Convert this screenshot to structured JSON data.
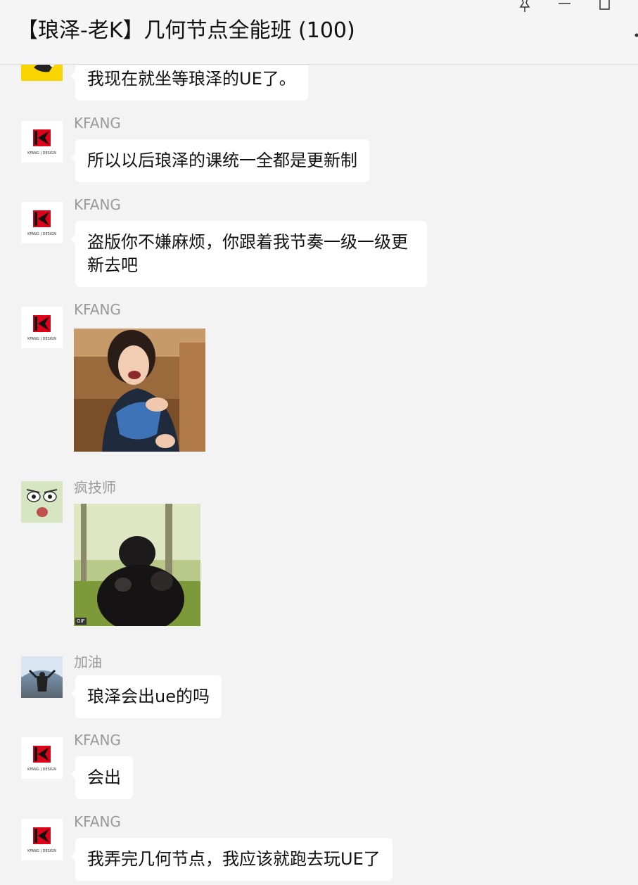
{
  "window": {
    "title": "【琅泽-老K】几何节点全能班 (100)"
  },
  "messages": [
    {
      "sender": "",
      "type": "text",
      "text": "我现在就坐等琅泽的UE了。"
    },
    {
      "sender": "KFANG",
      "type": "text",
      "text": "所以以后琅泽的课统一全都是更新制"
    },
    {
      "sender": "KFANG",
      "type": "text",
      "text": "盗版你不嫌麻烦，你跟着我节奏一级一级更新去吧"
    },
    {
      "sender": "KFANG",
      "type": "image",
      "image": "laughing-girl-pointing-sticker"
    },
    {
      "sender": "疯技师",
      "type": "image",
      "image": "gorilla-gif",
      "badge": "GIF"
    },
    {
      "sender": "加油",
      "type": "text",
      "text": "琅泽会出ue的吗"
    },
    {
      "sender": "KFANG",
      "type": "text",
      "text": "会出"
    },
    {
      "sender": "KFANG",
      "type": "text",
      "text": "我弄完几何节点，我应该就跑去玩UE了"
    }
  ],
  "logo": {
    "brand_text": "KFANG | DESIGN"
  },
  "icons": [
    "pin-icon",
    "minimize-icon",
    "maximize-icon",
    "more-icon"
  ],
  "colors": {
    "background": "#f3f3f3",
    "bubble": "#ffffff",
    "sender": "#9a9a9a",
    "logo_red": "#e0001a"
  }
}
